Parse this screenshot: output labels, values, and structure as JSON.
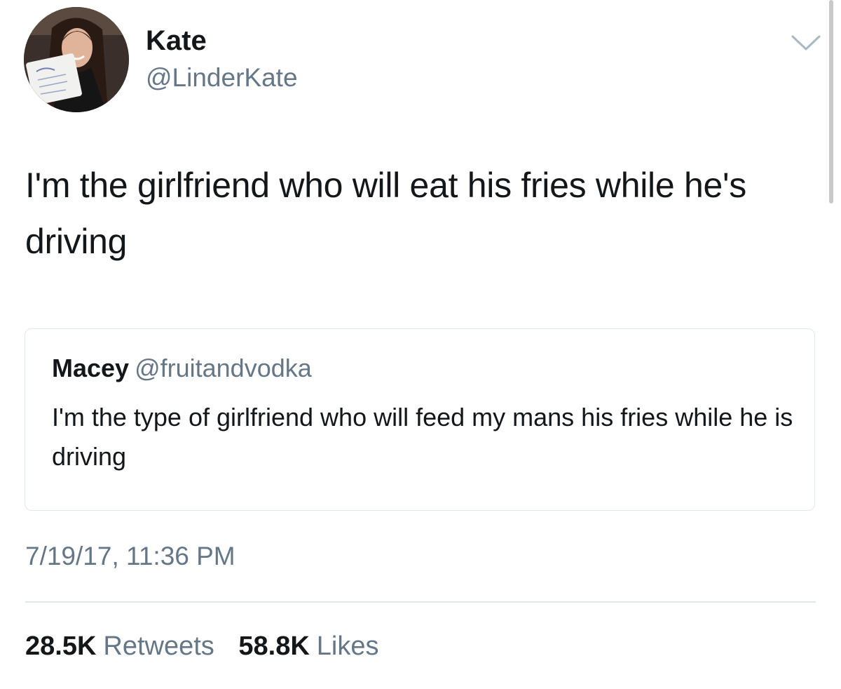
{
  "tweet": {
    "author": {
      "display_name": "Kate",
      "handle": "@LinderKate"
    },
    "text": "I'm the girlfriend who will eat his fries while he's driving",
    "quoted_tweet": {
      "display_name": "Macey",
      "handle": "@fruitandvodka",
      "text": "I'm the type of girlfriend who will feed my mans his fries while he is driving"
    },
    "timestamp": "7/19/17, 11:36 PM",
    "stats": {
      "retweets_count": "28.5K",
      "retweets_label": "Retweets",
      "likes_count": "58.8K",
      "likes_label": "Likes"
    }
  },
  "icons": {
    "menu": "chevron-down-icon"
  },
  "colors": {
    "primary_text": "#14171a",
    "secondary_text": "#657786",
    "border": "#e1e8ed"
  }
}
